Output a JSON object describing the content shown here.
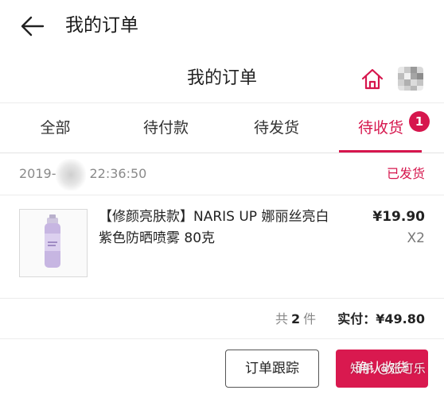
{
  "appbar": {
    "title": "我的订单"
  },
  "header": {
    "title": "我的订单"
  },
  "tabs": [
    {
      "label": "全部"
    },
    {
      "label": "待付款"
    },
    {
      "label": "待发货"
    },
    {
      "label": "待收货",
      "badge": "1"
    }
  ],
  "order": {
    "time_prefix": "2019-",
    "time": "22:36:50",
    "status": "已发货",
    "item": {
      "name": "【修颜亮肤款】NARIS UP 娜丽丝亮白紫色防晒喷雾 80克",
      "price": "¥19.90",
      "qty": "X2"
    },
    "summary": {
      "count_prefix": "共",
      "count": "2",
      "count_suffix": "件",
      "total": "实付：¥49.80"
    }
  },
  "actions": {
    "track_label": "订单跟踪",
    "confirm_label": "确认收货"
  },
  "watermark": "知乎 @张可乐",
  "colors": {
    "accent": "#d6164d",
    "confirm_button": "#d9194f"
  },
  "icons": [
    "back-arrow-icon",
    "home-icon",
    "avatar"
  ]
}
